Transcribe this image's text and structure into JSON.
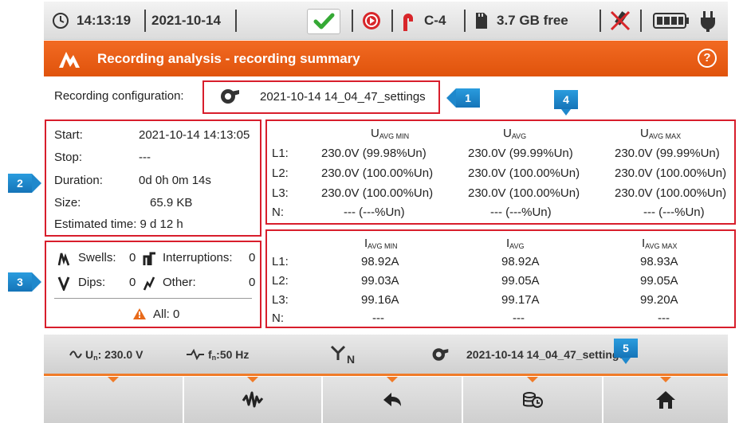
{
  "status": {
    "time": "14:13:19",
    "date": "2021-10-14",
    "channel": "C-4",
    "storage": "3.7 GB free"
  },
  "titlebar": {
    "title": "Recording analysis - recording summary",
    "help": "?"
  },
  "config": {
    "label": "Recording configuration:",
    "value": "2021-10-14 14_04_47_settings"
  },
  "markers": {
    "m1": "1",
    "m2": "2",
    "m3": "3",
    "m4": "4",
    "m5": "5"
  },
  "summary": {
    "start_label": "Start:",
    "start_value": "2021-10-14 14:13:05",
    "stop_label": "Stop:",
    "stop_value": "---",
    "duration_label": "Duration:",
    "duration_value": "0d 0h 0m 14s",
    "size_label": "Size:",
    "size_value": "65.9 KB",
    "estimated": "Estimated time: 9 d 12 h"
  },
  "events": {
    "swells_label": "Swells:",
    "swells_value": "0",
    "interruptions_label": "Interruptions:",
    "interruptions_value": "0",
    "dips_label": "Dips:",
    "dips_value": "0",
    "other_label": "Other:",
    "other_value": "0",
    "all_label": "All: 0"
  },
  "voltage": {
    "headers": [
      {
        "main": "U",
        "sub": "AVG MIN"
      },
      {
        "main": "U",
        "sub": "AVG"
      },
      {
        "main": "U",
        "sub": "AVG MAX"
      }
    ],
    "rows": [
      {
        "label": "L1:",
        "cells": [
          "230.0V (99.98%Un)",
          "230.0V (99.99%Un)",
          "230.0V (99.99%Un)"
        ]
      },
      {
        "label": "L2:",
        "cells": [
          "230.0V (100.00%Un)",
          "230.0V (100.00%Un)",
          "230.0V (100.00%Un)"
        ]
      },
      {
        "label": "L3:",
        "cells": [
          "230.0V (100.00%Un)",
          "230.0V (100.00%Un)",
          "230.0V (100.00%Un)"
        ]
      },
      {
        "label": "N:",
        "cells": [
          "--- (---%Un)",
          "--- (---%Un)",
          "--- (---%Un)"
        ]
      }
    ]
  },
  "current": {
    "headers": [
      {
        "main": "I",
        "sub": "AVG MIN"
      },
      {
        "main": "I",
        "sub": "AVG"
      },
      {
        "main": "I",
        "sub": "AVG MAX"
      }
    ],
    "rows": [
      {
        "label": "L1:",
        "cells": [
          "98.92A",
          "98.92A",
          "98.93A"
        ]
      },
      {
        "label": "L2:",
        "cells": [
          "99.03A",
          "99.05A",
          "99.05A"
        ]
      },
      {
        "label": "L3:",
        "cells": [
          "99.16A",
          "99.17A",
          "99.20A"
        ]
      },
      {
        "label": "N:",
        "cells": [
          "---",
          "---",
          "---"
        ]
      }
    ]
  },
  "infobar": {
    "un_label": "U",
    "un_sub": "n",
    "un_value": ": 230.0 V",
    "fn_label": "f",
    "fn_sub": "n",
    "fn_value": ":50 Hz",
    "network": "N",
    "settings": "2021-10-14 14_04_47_settings"
  },
  "colors": {
    "accent": "#e8601a",
    "frame": "#d81e2c",
    "marker": "#1f88cc"
  }
}
